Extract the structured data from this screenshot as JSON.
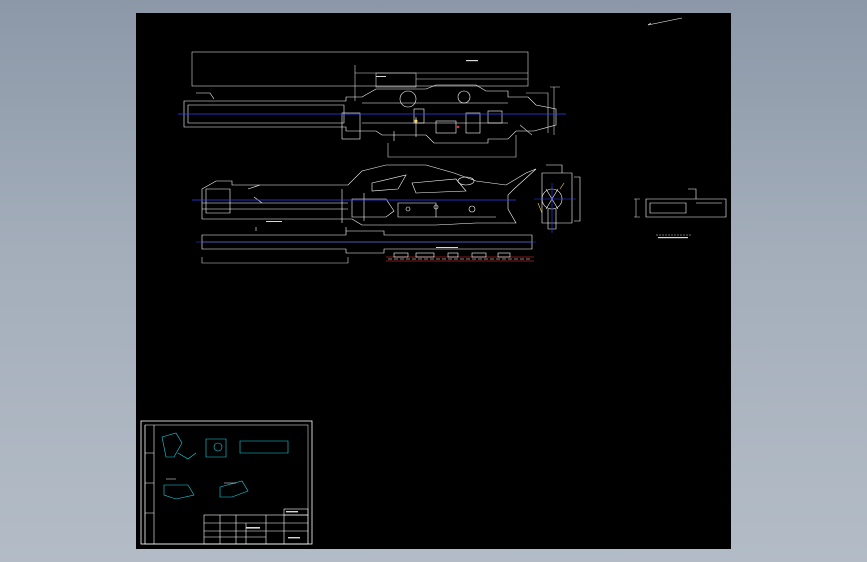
{
  "viewer": {
    "background": "gradient-gray",
    "drawing_background": "#000000"
  },
  "drawing": {
    "colors": {
      "line": "#ffffff",
      "centerline": "#3040ff",
      "dimension": "#e0e0e0",
      "hatch_red": "#ff3030",
      "thumbnail": "#19d6e6",
      "yellow": "#ffe040"
    },
    "labels": {
      "title_block_name": "",
      "section_label": "",
      "scale_note": ""
    }
  }
}
